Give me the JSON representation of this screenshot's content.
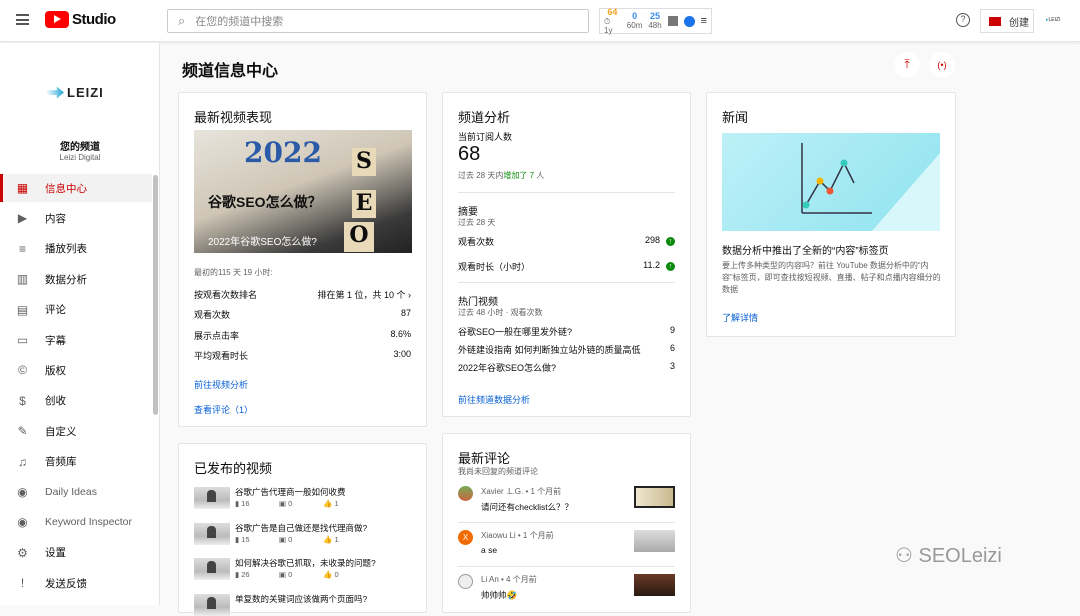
{
  "header": {
    "brand": "Studio",
    "search_placeholder": "在您的频道中搜索",
    "ext": {
      "v1": "64",
      "l1": "⏱ 1y",
      "v2": "0",
      "l2": "60m",
      "v3": "25",
      "l3": "48h"
    },
    "create_label": "创建"
  },
  "sidebar": {
    "channel_label": "您的频道",
    "channel_name": "Leizi Digital",
    "logo_text": "LEIZI",
    "items": [
      {
        "label": "信息中心",
        "icon": "dashboard-icon"
      },
      {
        "label": "内容",
        "icon": "content-icon"
      },
      {
        "label": "播放列表",
        "icon": "playlist-icon"
      },
      {
        "label": "数据分析",
        "icon": "analytics-icon"
      },
      {
        "label": "评论",
        "icon": "comments-icon"
      },
      {
        "label": "字幕",
        "icon": "subtitles-icon"
      },
      {
        "label": "版权",
        "icon": "copyright-icon"
      },
      {
        "label": "创收",
        "icon": "monetization-icon"
      },
      {
        "label": "自定义",
        "icon": "customize-icon"
      },
      {
        "label": "音频库",
        "icon": "audio-library-icon"
      },
      {
        "label": "Daily Ideas",
        "icon": "daily-ideas-icon"
      },
      {
        "label": "Keyword Inspector",
        "icon": "keyword-inspector-icon"
      },
      {
        "label": "设置",
        "icon": "settings-icon"
      },
      {
        "label": "发送反馈",
        "icon": "feedback-icon"
      }
    ]
  },
  "page_title": "频道信息中心",
  "latest": {
    "title": "最新视频表现",
    "thumb_year": "2022",
    "thumb_text": "谷歌SEO怎么做？",
    "thumb_caption": "2022年谷歌SEO怎么做?",
    "period": "最初的115 天 19 小时:",
    "rows": [
      {
        "label": "按观看次数排名",
        "value": "排在第 1 位，共 10 个 ›"
      },
      {
        "label": "观看次数",
        "value": "87"
      },
      {
        "label": "展示点击率",
        "value": "8.6%"
      },
      {
        "label": "平均观看时长",
        "value": "3:00"
      }
    ],
    "link1": "前往视频分析",
    "link2": "查看评论（1）"
  },
  "published": {
    "title": "已发布的视频",
    "videos": [
      {
        "title": "谷歌广告代理商一般如何收费",
        "views": "16",
        "comments": "0",
        "likes": "1"
      },
      {
        "title": "谷歌广告是自己做还是找代理商做?",
        "views": "15",
        "comments": "0",
        "likes": "1"
      },
      {
        "title": "如何解决谷歌已抓取，未收录的问题?",
        "views": "26",
        "comments": "0",
        "likes": "0"
      },
      {
        "title": "单复数的关键词应该做两个页面吗?",
        "views": "",
        "comments": "",
        "likes": ""
      }
    ]
  },
  "analytics": {
    "title": "频道分析",
    "subs_label": "当前订阅人数",
    "subs": "68",
    "subs_change_pre": "过去 28 天内",
    "subs_change": "增加了 7",
    "subs_change_post": " 人",
    "summary_title": "摘要",
    "summary_period": "过去 28 天",
    "summary": [
      {
        "label": "观看次数",
        "value": "298"
      },
      {
        "label": "观看时长（小时）",
        "value": "11.2"
      }
    ],
    "top_title": "热门视频",
    "top_period": "过去 48 小时 · 观看次数",
    "top": [
      {
        "title": "谷歌SEO一般在哪里发外链?",
        "value": "9"
      },
      {
        "title": "外链建设指南 如何判断独立站外链的质量高低",
        "value": "6"
      },
      {
        "title": "2022年谷歌SEO怎么做?",
        "value": "3"
      }
    ],
    "link": "前往频道数据分析"
  },
  "comments": {
    "title": "最新评论",
    "subtitle": "我尚未回复的频道评论",
    "items": [
      {
        "author": "Xavier .L.G. • 1 个月前",
        "text": "请问还有checklist么？？",
        "avatar": ""
      },
      {
        "author": "Xiaowu Li • 1 个月前",
        "text": "a se",
        "avatar": "X"
      },
      {
        "author": "Li An • 4 个月前",
        "text": "帅帅帅🤣",
        "avatar": ""
      }
    ]
  },
  "news": {
    "title": "新闻",
    "headline": "数据分析中推出了全新的“内容”标签页",
    "body": "要上传多种类型的内容吗？前往 YouTube 数据分析中的“内容”标签页，即可查找按短视频、直播、帖子和点播内容细分的数据",
    "link": "了解详情"
  },
  "watermark": "SEOLeizi",
  "colors": {
    "accent": "#cc0000",
    "link": "#065fd4",
    "positive": "#0a8a0a"
  }
}
